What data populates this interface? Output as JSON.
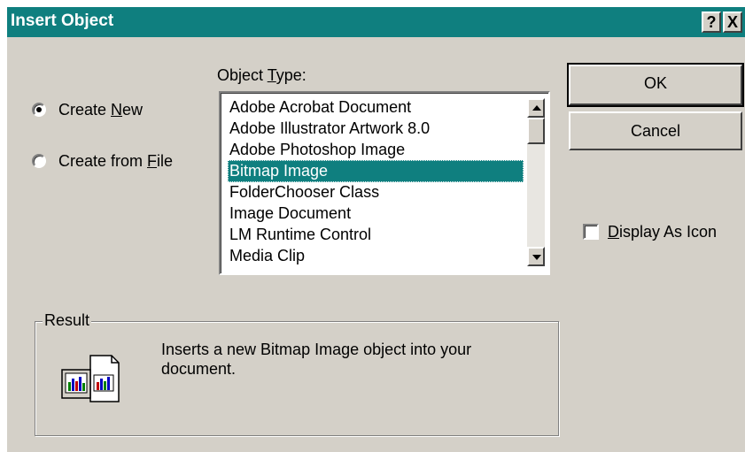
{
  "dialog": {
    "title": "Insert Object",
    "help_glyph": "?",
    "close_glyph": "X"
  },
  "options": {
    "create_new": {
      "label_before": "Create ",
      "accel": "N",
      "label_after": "ew",
      "selected": true
    },
    "create_from_file": {
      "label_before": "Create from ",
      "accel": "F",
      "label_after": "ile",
      "selected": false
    }
  },
  "object_type": {
    "label_before": "Object ",
    "accel": "T",
    "label_after": "ype:",
    "items": [
      "Adobe Acrobat Document",
      "Adobe Illustrator Artwork 8.0",
      "Adobe Photoshop Image",
      "Bitmap Image",
      "FolderChooser Class",
      "Image Document",
      "LM Runtime Control",
      "Media Clip"
    ],
    "selected_index": 3
  },
  "buttons": {
    "ok": "OK",
    "cancel": "Cancel"
  },
  "display_as_icon": {
    "label_before": "",
    "accel": "D",
    "label_after": "isplay As Icon",
    "checked": false
  },
  "result": {
    "label": "Result",
    "text": "Inserts a new Bitmap Image object into your document.",
    "icon": "bitmap-image-icon"
  },
  "colors": {
    "title_bar": "#0f7f7f",
    "face": "#d4d0c8",
    "selection": "#0f7f7f"
  }
}
